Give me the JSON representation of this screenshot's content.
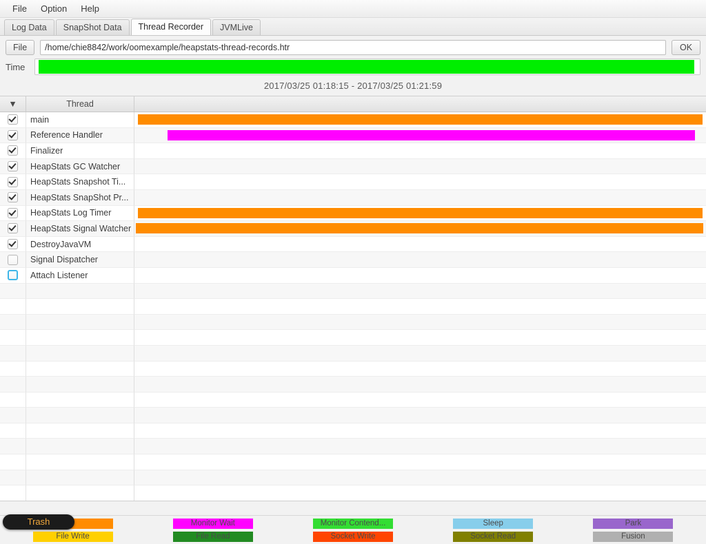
{
  "menubar": {
    "items": [
      {
        "label": "File"
      },
      {
        "label": "Option"
      },
      {
        "label": "Help"
      }
    ]
  },
  "tabs": [
    {
      "label": "Log Data",
      "active": false
    },
    {
      "label": "SnapShot Data",
      "active": false
    },
    {
      "label": "Thread Recorder",
      "active": true
    },
    {
      "label": "JVMLive",
      "active": false
    }
  ],
  "file_row": {
    "button_label": "File",
    "path_value": "/home/chie8842/work/oomexample/heapstats-thread-records.htr",
    "ok_label": "OK"
  },
  "time_row": {
    "label": "Time",
    "fill_color": "#00ee00"
  },
  "range_caption": "2017/03/25 01:18:15  -  2017/03/25 01:21:59",
  "table": {
    "headers": {
      "sort_indicator": "▼",
      "thread": "Thread",
      "chart": ""
    },
    "rows": [
      {
        "name": "main",
        "checked": true,
        "focused": false,
        "bars": [
          {
            "left_pct": 0.6,
            "width_pct": 98.8,
            "color": "#ff8c00"
          }
        ]
      },
      {
        "name": "Reference Handler",
        "checked": true,
        "focused": false,
        "bars": [
          {
            "left_pct": 5.8,
            "width_pct": 92.3,
            "color": "#ff00ff"
          }
        ]
      },
      {
        "name": "Finalizer",
        "checked": true,
        "focused": false,
        "bars": []
      },
      {
        "name": "HeapStats GC Watcher",
        "checked": true,
        "focused": false,
        "bars": []
      },
      {
        "name": "HeapStats Snapshot Ti...",
        "checked": true,
        "focused": false,
        "bars": []
      },
      {
        "name": "HeapStats SnapShot Pr...",
        "checked": true,
        "focused": false,
        "bars": []
      },
      {
        "name": "HeapStats Log Timer",
        "checked": true,
        "focused": false,
        "bars": [
          {
            "left_pct": 0.6,
            "width_pct": 98.8,
            "color": "#ff8c00"
          }
        ]
      },
      {
        "name": "HeapStats Signal Watcher",
        "checked": true,
        "focused": false,
        "bars": [
          {
            "left_pct": 0.3,
            "width_pct": 99.2,
            "color": "#ff8c00"
          }
        ]
      },
      {
        "name": "DestroyJavaVM",
        "checked": true,
        "focused": false,
        "bars": []
      },
      {
        "name": "Signal Dispatcher",
        "checked": false,
        "focused": false,
        "bars": []
      },
      {
        "name": "Attach Listener",
        "checked": false,
        "focused": true,
        "bars": []
      }
    ],
    "empty_row_count": 15
  },
  "legend": {
    "rows": [
      [
        {
          "label": "",
          "color": "#ff8c00",
          "text_color": "#4a4a4a"
        },
        {
          "label": "Monitor Wait",
          "color": "#ff00ff",
          "text_color": "#4a4a4a"
        },
        {
          "label": "Monitor Contend...",
          "color": "#33dd33",
          "text_color": "#4a4a4a"
        },
        {
          "label": "Sleep",
          "color": "#87ceeb",
          "text_color": "#4a4a4a"
        },
        {
          "label": "Park",
          "color": "#9966cc",
          "text_color": "#4a4a4a"
        }
      ],
      [
        {
          "label": "File Write",
          "color": "#ffd000",
          "text_color": "#4a4a4a"
        },
        {
          "label": "File Read",
          "color": "#228b22",
          "text_color": "#4a4a4a"
        },
        {
          "label": "Socket Write",
          "color": "#ff4500",
          "text_color": "#4a4a4a"
        },
        {
          "label": "Socket Read",
          "color": "#808000",
          "text_color": "#4a4a4a"
        },
        {
          "label": "Fusion",
          "color": "#b0b0b0",
          "text_color": "#4a4a4a"
        }
      ]
    ]
  },
  "dock_tooltip": {
    "label": "Trash"
  }
}
